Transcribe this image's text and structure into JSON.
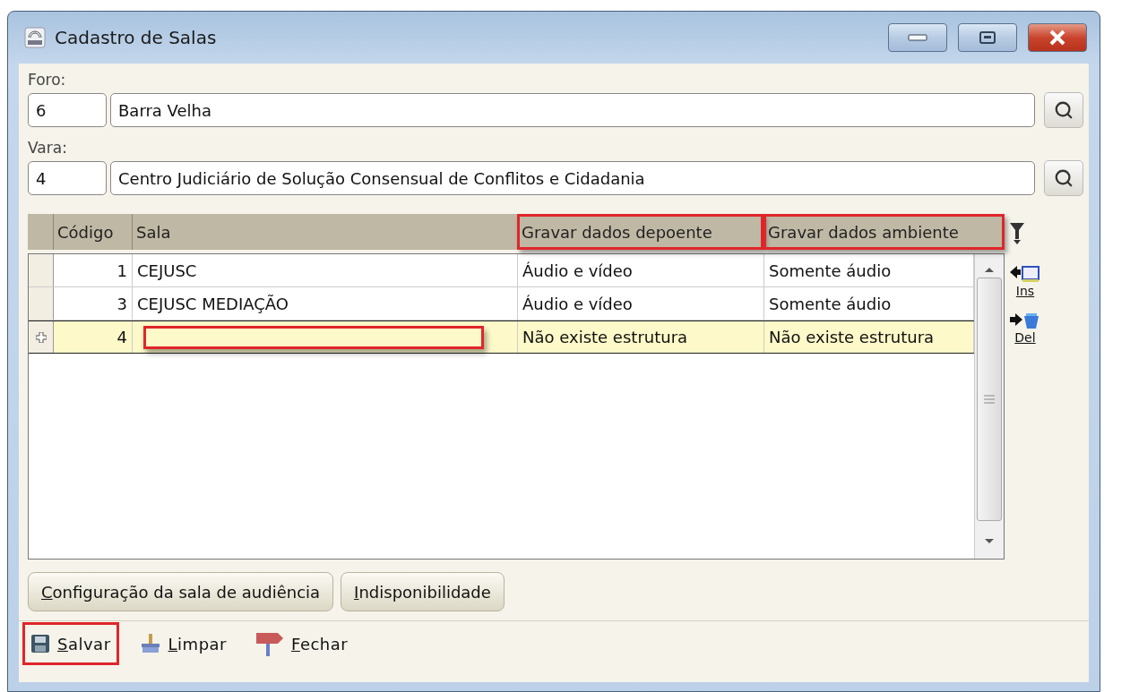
{
  "window": {
    "title": "Cadastro de Salas"
  },
  "foro": {
    "label": "Foro:",
    "code": "6",
    "name": "Barra Velha"
  },
  "vara": {
    "label": "Vara:",
    "code": "4",
    "name": "Centro Judiciário de Solução Consensual de Conflitos e Cidadania"
  },
  "table": {
    "columns": [
      {
        "label": "Código",
        "highlight": false
      },
      {
        "label": "Sala",
        "highlight": false
      },
      {
        "label": "Gravar dados depoente",
        "highlight": true
      },
      {
        "label": "Gravar dados ambiente",
        "highlight": true
      }
    ],
    "rows": [
      {
        "codigo": "1",
        "sala": "CEJUSC",
        "depoente": "Áudio e vídeo",
        "ambiente": "Somente áudio",
        "selected": false,
        "sala_highlight": false
      },
      {
        "codigo": "3",
        "sala": "CEJUSC MEDIAÇÃO",
        "depoente": "Áudio e vídeo",
        "ambiente": "Somente áudio",
        "selected": false,
        "sala_highlight": false
      },
      {
        "codigo": "4",
        "depoente": "Não existe estrutura",
        "ambiente": "Não existe estrutura",
        "selected": true,
        "sala_highlight": true
      }
    ]
  },
  "side_actions": [
    {
      "kind": "insert",
      "label": "Ins"
    },
    {
      "kind": "delete",
      "label": "Del"
    }
  ],
  "buttons": [
    {
      "accel": "C",
      "rest": "onfiguração da sala de audiência"
    },
    {
      "accel": "I",
      "rest": "ndisponibilidade"
    }
  ],
  "toolbar": [
    {
      "kind": "save",
      "accel": "S",
      "rest": "alvar",
      "highlight": true
    },
    {
      "kind": "clear",
      "accel": "L",
      "rest": "impar",
      "highlight": false
    },
    {
      "kind": "close",
      "accel": "F",
      "rest": "echar",
      "highlight": false
    }
  ]
}
